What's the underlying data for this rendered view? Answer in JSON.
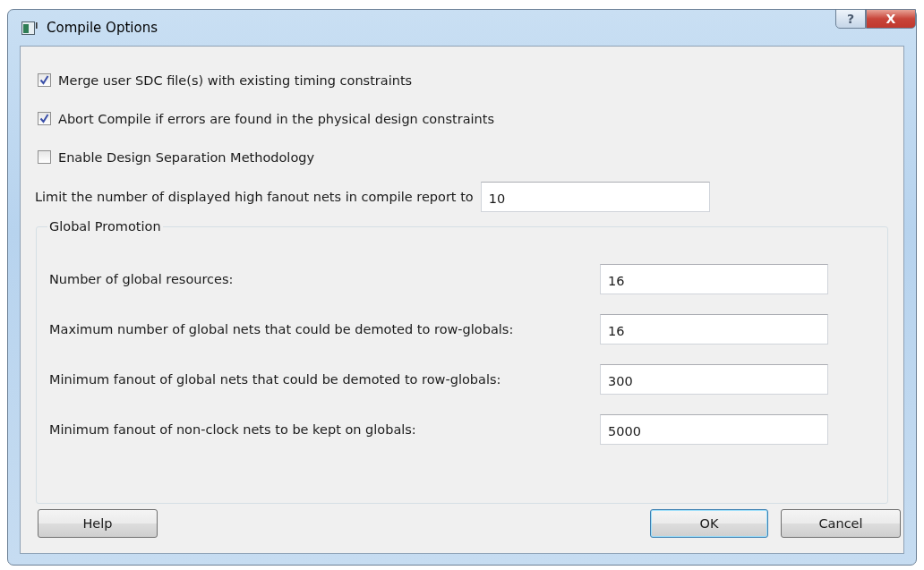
{
  "window": {
    "title": "Compile Options",
    "help_button": "?",
    "close_button": "X"
  },
  "options": [
    {
      "label": "Merge user SDC file(s) with existing timing constraints",
      "checked": true
    },
    {
      "label": "Abort Compile if errors are found in the physical design constraints",
      "checked": true
    },
    {
      "label": "Enable Design Separation Methodology",
      "checked": false
    }
  ],
  "limit": {
    "label": "Limit the number of displayed high fanout nets in compile report to",
    "value": "10"
  },
  "global_promotion": {
    "title": "Global Promotion",
    "fields": [
      {
        "label": "Number of global resources:",
        "value": "16"
      },
      {
        "label": "Maximum number of global nets that could be demoted to row-globals:",
        "value": "16"
      },
      {
        "label": "Minimum fanout of global nets that could be demoted to row-globals:",
        "value": "300"
      },
      {
        "label": "Minimum fanout of non-clock nets to be kept on globals:",
        "value": "5000"
      }
    ]
  },
  "buttons": {
    "help": "Help",
    "ok": "OK",
    "cancel": "Cancel"
  }
}
